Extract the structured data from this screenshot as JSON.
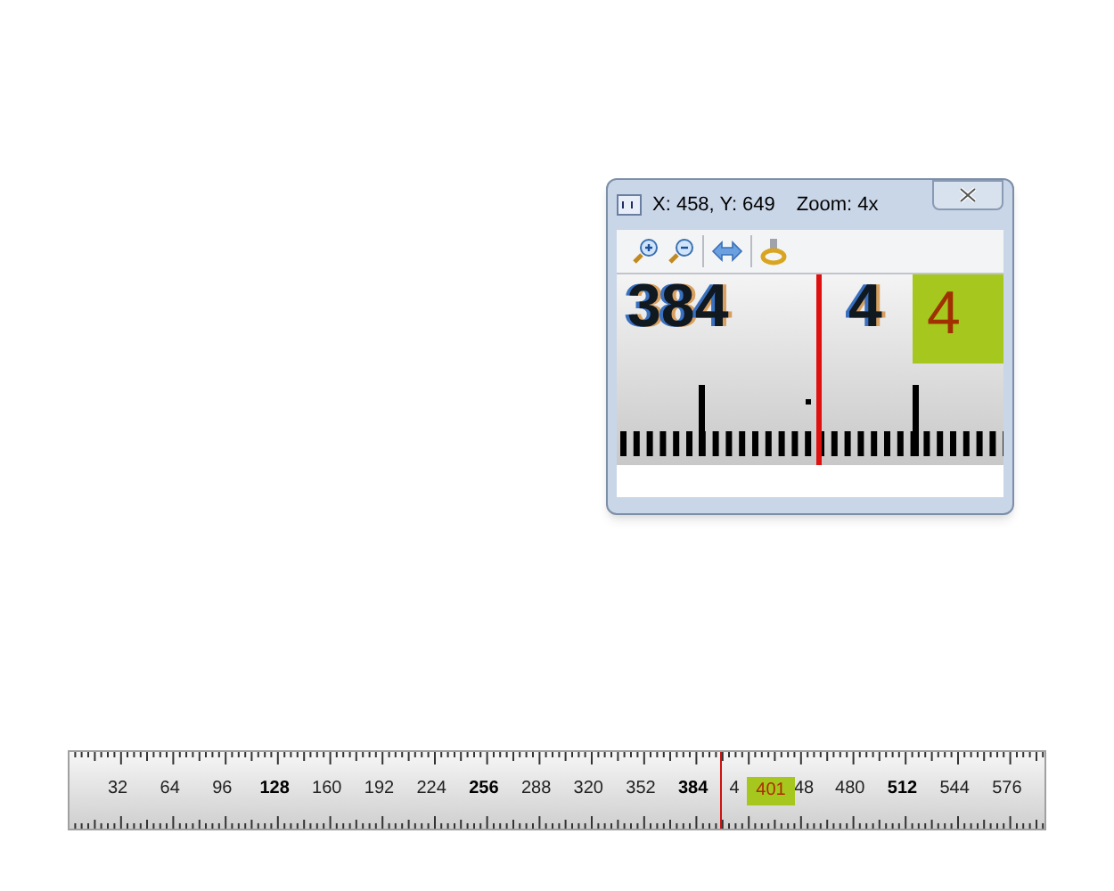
{
  "magnifier": {
    "title": "X: 458, Y: 649",
    "zoom": "Zoom: 4x",
    "view_labels": [
      {
        "text": "384",
        "kind": "plain"
      },
      {
        "text": "4",
        "kind": "plain"
      },
      {
        "text": "4",
        "kind": "highlight"
      }
    ]
  },
  "ruler": {
    "labels": [
      {
        "text": "32",
        "major": false,
        "kind": "full"
      },
      {
        "text": "64",
        "major": false,
        "kind": "full"
      },
      {
        "text": "96",
        "major": false,
        "kind": "full"
      },
      {
        "text": "128",
        "major": true,
        "kind": "full"
      },
      {
        "text": "160",
        "major": false,
        "kind": "full"
      },
      {
        "text": "192",
        "major": false,
        "kind": "full"
      },
      {
        "text": "224",
        "major": false,
        "kind": "full"
      },
      {
        "text": "256",
        "major": true,
        "kind": "full"
      },
      {
        "text": "288",
        "major": false,
        "kind": "full"
      },
      {
        "text": "320",
        "major": false,
        "kind": "full"
      },
      {
        "text": "352",
        "major": false,
        "kind": "full"
      },
      {
        "text": "384",
        "major": true,
        "kind": "full"
      },
      {
        "text": "4",
        "major": false,
        "kind": "cut-right"
      },
      {
        "text": "48",
        "major": false,
        "kind": "cut-left"
      },
      {
        "text": "480",
        "major": false,
        "kind": "full"
      },
      {
        "text": "512",
        "major": true,
        "kind": "full"
      },
      {
        "text": "544",
        "major": false,
        "kind": "full"
      },
      {
        "text": "576",
        "major": false,
        "kind": "full"
      }
    ],
    "marker": {
      "label": "401"
    }
  }
}
